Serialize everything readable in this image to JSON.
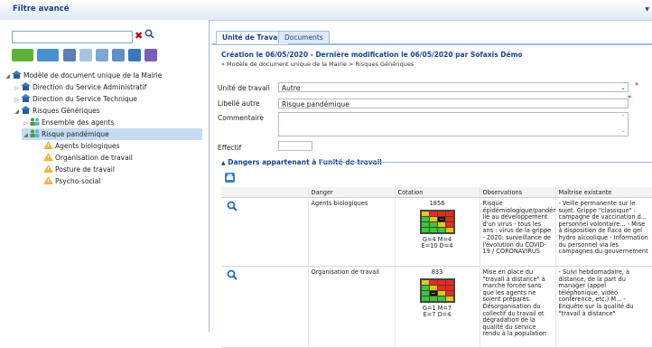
{
  "topbar": {
    "title": "Filtre avancé"
  },
  "colors": {
    "accent": "#15428b",
    "panel_border": "#99bbe8",
    "selected": "#c5dbf3"
  },
  "left": {
    "search": {
      "value": "",
      "clear_icon": "clear-x-icon",
      "search_icon": "search-icon"
    },
    "tree": [
      {
        "label": "Modèle de document unique de la Mairie",
        "icon": "home-icon",
        "level": 0,
        "expanded": true
      },
      {
        "label": "Direction du Service Administratif",
        "icon": "home-icon",
        "level": 1,
        "expanded": false
      },
      {
        "label": "Direction du Service Technique",
        "icon": "home-icon",
        "level": 1,
        "expanded": false
      },
      {
        "label": "Risques Génériques",
        "icon": "home-icon",
        "level": 1,
        "expanded": true
      },
      {
        "label": "Ensemble des agents",
        "icon": "people-icon",
        "level": 2,
        "expanded": false
      },
      {
        "label": "Risque pandémique",
        "icon": "people-icon",
        "level": 2,
        "expanded": true,
        "selected": true
      },
      {
        "label": "Agents biologiques",
        "icon": "warning-icon",
        "level": 3
      },
      {
        "label": "Organisation de travail",
        "icon": "warning-icon",
        "level": 3
      },
      {
        "label": "Posture de travail",
        "icon": "warning-icon",
        "level": 3
      },
      {
        "label": "Psycho-social",
        "icon": "warning-icon",
        "level": 3
      }
    ]
  },
  "right": {
    "tabs": [
      {
        "label": "Unité de Travail",
        "active": true
      },
      {
        "label": "Documents",
        "active": false
      }
    ],
    "created": "Création le 06/05/2020 - Dernière modification le 06/05/2020 par Sofaxis Démo",
    "breadcrumb": "» Modèle de document unique de la Mairie > Risques Génériques",
    "form": {
      "unite_label": "Unité de travail",
      "unite_value": "Autre",
      "libelle_label": "Libellé autre",
      "libelle_value": "Risque pandémique",
      "commentaire_label": "Commentaire",
      "commentaire_value": "",
      "effectif_label": "Effectif",
      "effectif_value": ""
    },
    "section_title": "Dangers appartenant à l'unité de travail",
    "table": {
      "headers": [
        "",
        "Danger",
        "Cotation",
        "Observations",
        "Maîtrise existante"
      ],
      "rows": [
        {
          "danger": "Agents biologiques",
          "score": "1856",
          "gm": "G=4 M=4",
          "ed": "E=10 D=4",
          "observations": "Risque épidémiologique/pandémique lié au développement d'un virus - tous les ans : virus de la grippe - 2020: surveillance de l'évolution du COVID-19 / CORONAVIRUS",
          "maitrise": "- Veille permanente sur le sujet. Grippe \"classique\" : campagne de vaccination d... personnel volontaire... - Mise à disposition de flaco de gel hydro alcoolique - Information du personnel via les campagnes du gouvernement",
          "marker": [
            1,
            2
          ]
        },
        {
          "danger": "Organisation de travail",
          "score": "833",
          "gm": "G=1 M=7",
          "ed": "E=7 D=4",
          "observations": "Mise en place du \"travail à distance\" à marche forcée sans que les agents ne soient préparés. Désorganisation du collectif du travail et dégradation de la qualité du service rendu à la population",
          "maitrise": "- Suivi hebdomadaire, à distance, de la part du manager (appel téléphonique, vidéo conférence, etc.) M... - Enquête sur la qualité du \"travail à distance\"",
          "marker": [
            2,
            1
          ]
        }
      ]
    }
  }
}
